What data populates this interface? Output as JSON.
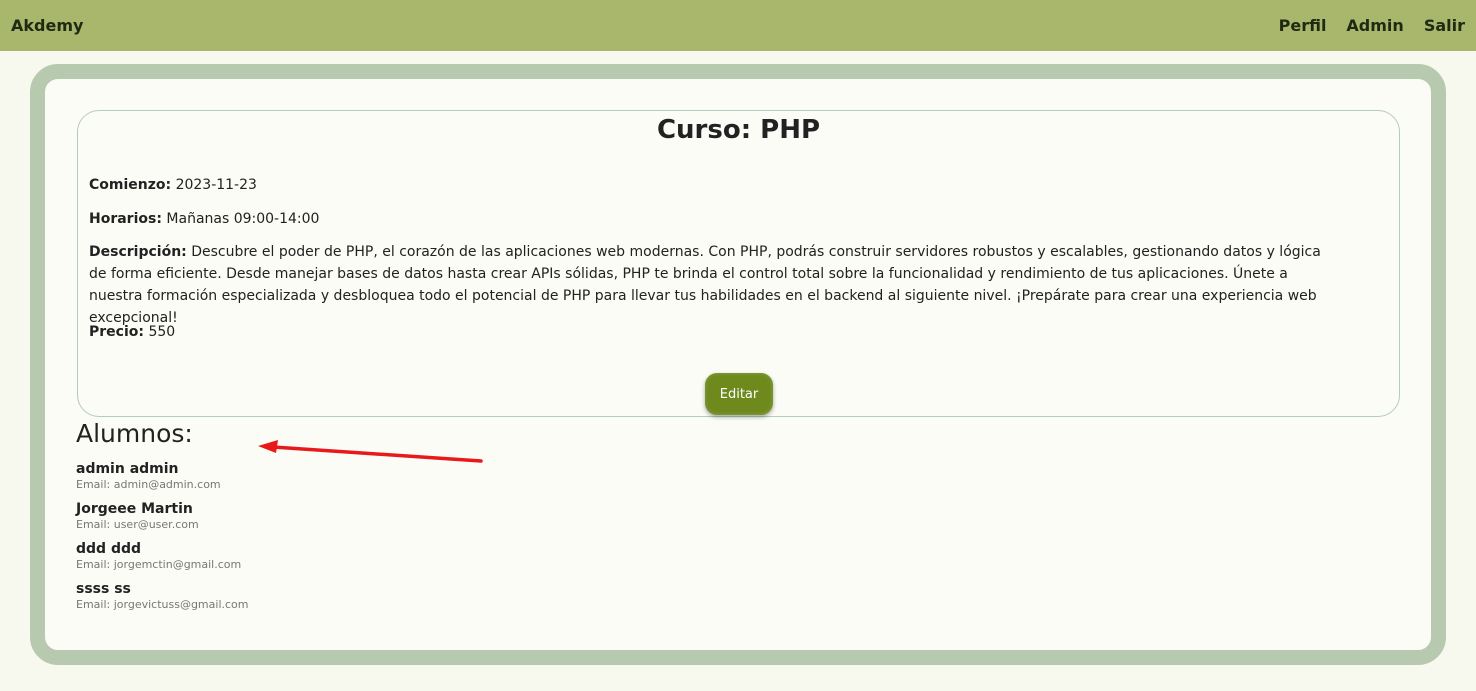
{
  "navbar": {
    "brand": "Akdemy",
    "links": [
      "Perfil",
      "Admin",
      "Salir"
    ]
  },
  "course": {
    "title": "Curso: PHP",
    "start_label": "Comienzo:",
    "start_value": "2023-11-23",
    "schedule_label": "Horarios:",
    "schedule_value": "Mañanas 09:00-14:00",
    "description_label": "Descripción:",
    "description_value": "Descubre el poder de PHP, el corazón de las aplicaciones web modernas. Con PHP, podrás construir servidores robustos y escalables, gestionando datos y lógica de forma eficiente. Desde manejar bases de datos hasta crear APIs sólidas, PHP te brinda el control total sobre la funcionalidad y rendimiento de tus aplicaciones. Únete a nuestra formación especializada y desbloquea todo el potencial de PHP para llevar tus habilidades en el backend al siguiente nivel. ¡Prepárate para crear una experiencia web excepcional!",
    "price_label": "Precio:",
    "price_value": "550",
    "edit_label": "Editar"
  },
  "students": {
    "heading": "Alumnos:",
    "items": [
      {
        "name": "admin admin",
        "email": "Email: admin@admin.com"
      },
      {
        "name": "Jorgeee Martin",
        "email": "Email: user@user.com"
      },
      {
        "name": "ddd ddd",
        "email": "Email: jorgemctin@gmail.com"
      },
      {
        "name": "ssss ss",
        "email": "Email: jorgevictuss@gmail.com"
      }
    ]
  },
  "annotation": {
    "arrow_color": "#e8191a"
  },
  "colors": {
    "navbar": "#a9b76d",
    "frame": "#b7cab0",
    "button": "#6e8a1d"
  }
}
